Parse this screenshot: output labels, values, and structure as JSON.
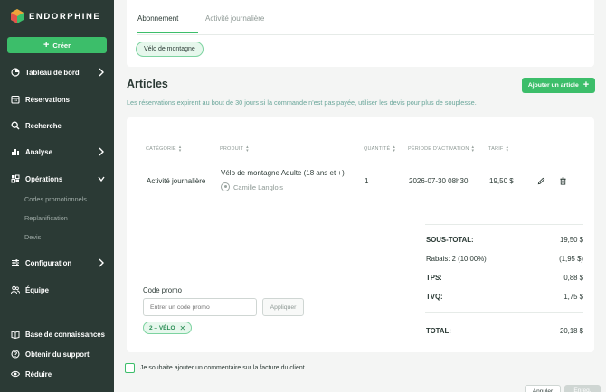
{
  "app": {
    "brand": "ENDORPHINE",
    "create_label": "Créer"
  },
  "sidebar": {
    "items": [
      {
        "label": "Tableau de bord",
        "icon": "dashboard-icon"
      },
      {
        "label": "Réservations",
        "icon": "calendar-icon"
      },
      {
        "label": "Recherche",
        "icon": "search-icon"
      },
      {
        "label": "Analyse",
        "icon": "chart-icon"
      },
      {
        "label": "Opérations",
        "icon": "operations-icon"
      },
      {
        "label": "Configuration",
        "icon": "sliders-icon"
      },
      {
        "label": "Équipe",
        "icon": "team-icon"
      }
    ],
    "sub_items": [
      "Codes promotionnels",
      "Replanification",
      "Devis"
    ],
    "bottom": [
      {
        "label": "Base de connaissances",
        "icon": "book-icon"
      },
      {
        "label": "Obtenir du support",
        "icon": "help-icon"
      },
      {
        "label": "Réduire",
        "icon": "eye-icon"
      }
    ]
  },
  "tabs": {
    "active": "Abonnement",
    "inactive": "Activité journalière"
  },
  "product_chip": "Vélo de montagne",
  "articles": {
    "title": "Articles",
    "add_label": "Ajouter un article",
    "info": "Les réservations expirent au bout de 30 jours si la commande n'est pas payée, utiliser les devis pour plus de souplesse.",
    "headers": {
      "category": "CATÉGORIE",
      "product": "PRODUIT",
      "quantity": "QUANTITÉ",
      "period": "PÉRIODE D'ACTIVATION",
      "rate": "TARIF"
    },
    "row": {
      "category": "Activité journalière",
      "product": "Vélo de montagne Adulte (18 ans et +)",
      "person": "Camille Langlois",
      "quantity": "1",
      "period": "2026-07-30 08h30",
      "rate": "19,50 $"
    }
  },
  "summary": {
    "subtotal_label": "SOUS-TOTAL:",
    "subtotal": "19,50 $",
    "discount_label": "Rabais: 2 (10.00%)",
    "discount": "(1,95 $)",
    "tps_label": "TPS:",
    "tps": "0,88 $",
    "tvq_label": "TVQ:",
    "tvq": "1,75 $",
    "total_label": "TOTAL:",
    "total": "20,18 $"
  },
  "promo": {
    "label": "Code promo",
    "placeholder": "Entrer un code promo",
    "apply": "Appliquer",
    "applied_code": "2 – VÉLO"
  },
  "comment_label": "Je souhaite ajouter un commentaire sur la facture du client",
  "footer": {
    "cancel": "Annuler",
    "save": "Enreg."
  },
  "colors": {
    "sidebar": "#2b3a35",
    "accent": "#3cbe6a",
    "info": "#6aa69a"
  }
}
